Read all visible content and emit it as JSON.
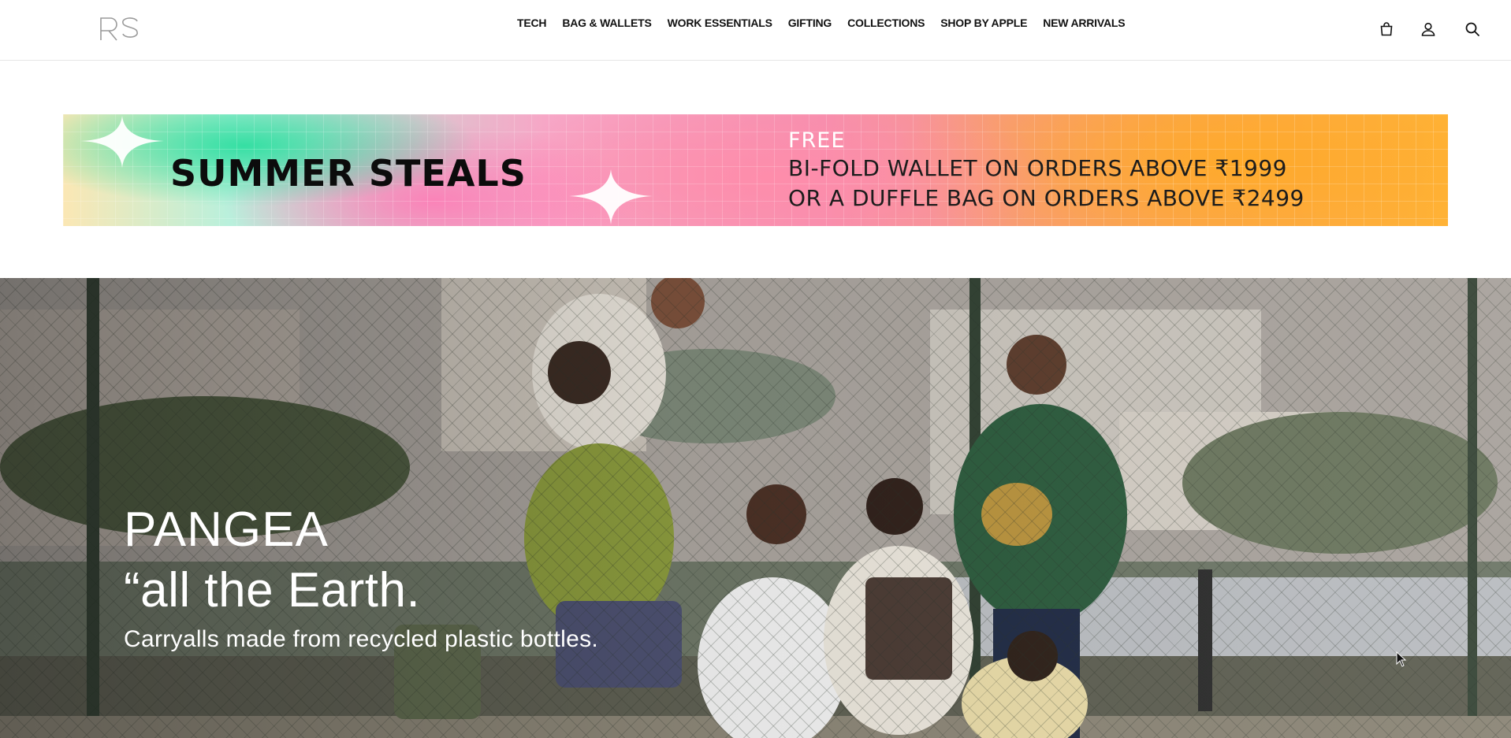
{
  "header": {
    "logo_text": "RS",
    "nav": [
      {
        "label": "TECH"
      },
      {
        "label": "BAG & WALLETS"
      },
      {
        "label": "WORK ESSENTIALS"
      },
      {
        "label": "GIFTING"
      },
      {
        "label": "COLLECTIONS"
      },
      {
        "label": "SHOP BY APPLE"
      },
      {
        "label": "NEW ARRIVALS"
      }
    ],
    "icons": [
      "bag-icon",
      "user-icon",
      "search-icon"
    ]
  },
  "banner": {
    "headline": "SUMMER STEALS",
    "free_label": "FREE",
    "offer_line_1": "BI-FOLD WALLET ON ORDERS ABOVE ₹1999",
    "offer_line_2": "OR A DUFFLE BAG ON ORDERS ABOVE ₹2499",
    "colors": {
      "green": "#2edea0",
      "pink": "#f58fae",
      "orange": "#ffb53a"
    }
  },
  "hero": {
    "title": "PANGEA",
    "subtitle": "“all the Earth.",
    "tagline": "Carryalls made from recycled plastic bottles."
  }
}
